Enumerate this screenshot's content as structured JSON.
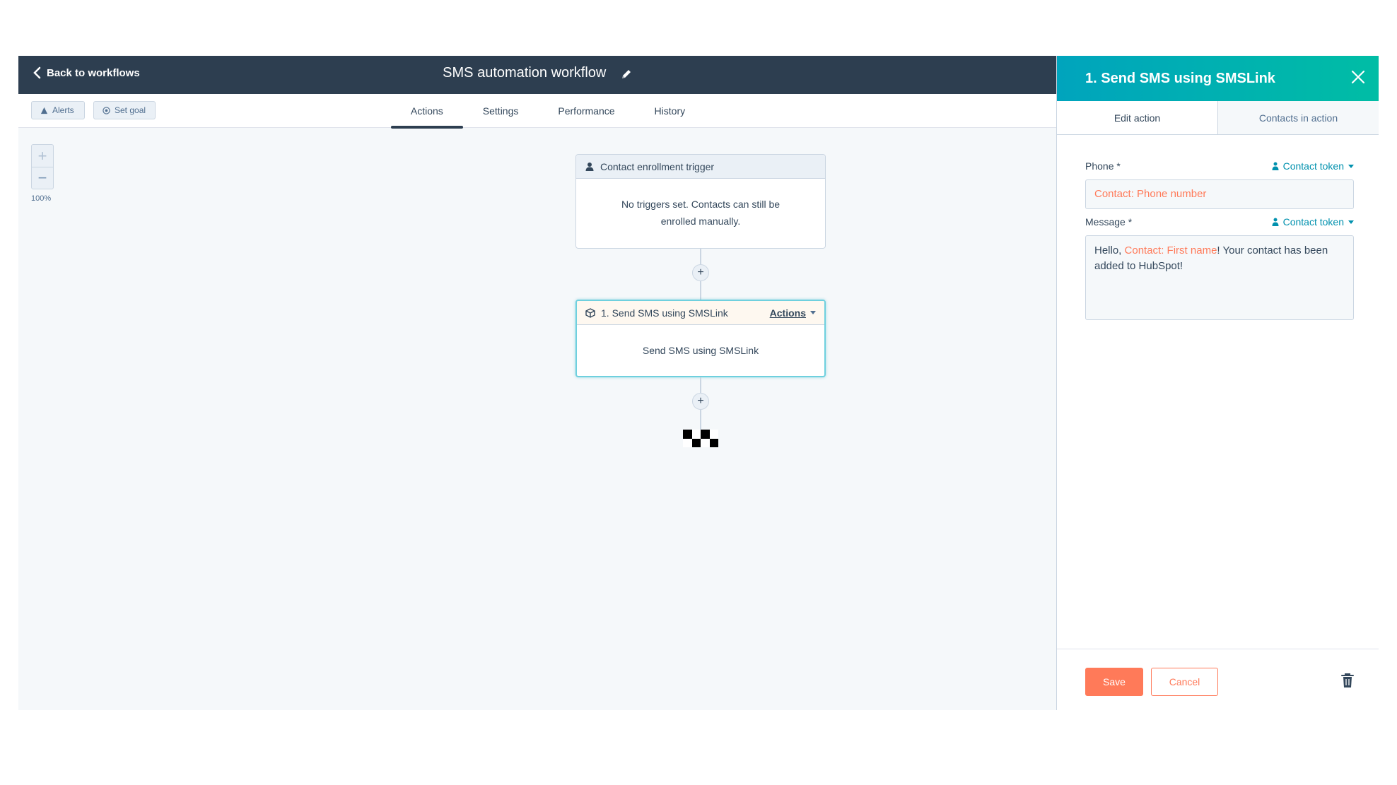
{
  "header": {
    "back_label": "Back to workflows",
    "workflow_title": "SMS automation workflow"
  },
  "toolbar": {
    "alerts_label": "Alerts",
    "set_goal_label": "Set goal"
  },
  "tabs": [
    {
      "label": "Actions",
      "active": true
    },
    {
      "label": "Settings",
      "active": false
    },
    {
      "label": "Performance",
      "active": false
    },
    {
      "label": "History",
      "active": false
    }
  ],
  "zoom": {
    "in_label": "+",
    "out_label": "−",
    "level": "100%"
  },
  "trigger_card": {
    "title": "Contact enrollment trigger",
    "body": "No triggers set. Contacts can still be enrolled manually."
  },
  "action_card": {
    "title": "1. Send SMS using SMSLink",
    "actions_label": "Actions",
    "body": "Send SMS using SMSLink"
  },
  "connectors": {
    "plus_label": "+"
  },
  "panel": {
    "title": "1. Send SMS using SMSLink",
    "tabs": [
      {
        "label": "Edit action",
        "active": true
      },
      {
        "label": "Contacts in action",
        "active": false
      }
    ],
    "phone": {
      "label": "Phone *",
      "token_link": "Contact token",
      "value": "Contact: Phone number"
    },
    "message": {
      "label": "Message *",
      "token_link": "Contact token",
      "prefix": "Hello, ",
      "token": "Contact: First name",
      "suffix": "! Your contact has been added to HubSpot!"
    },
    "save_label": "Save",
    "cancel_label": "Cancel"
  },
  "colors": {
    "header_bg": "#2d3e50",
    "panel_header_start": "#00a4bd",
    "panel_header_end": "#00bda5",
    "accent_orange": "#ff7a59",
    "link_teal": "#0091ae",
    "canvas_bg": "#f5f8fa"
  },
  "icons": {
    "back": "chevron-left-icon",
    "edit": "pencil-icon",
    "alerts": "warning-triangle-icon",
    "goal": "target-icon",
    "trigger": "person-icon",
    "action": "cube-icon",
    "close": "close-icon",
    "token": "person-icon",
    "delete": "trash-icon",
    "end": "checkered-flag-icon"
  }
}
